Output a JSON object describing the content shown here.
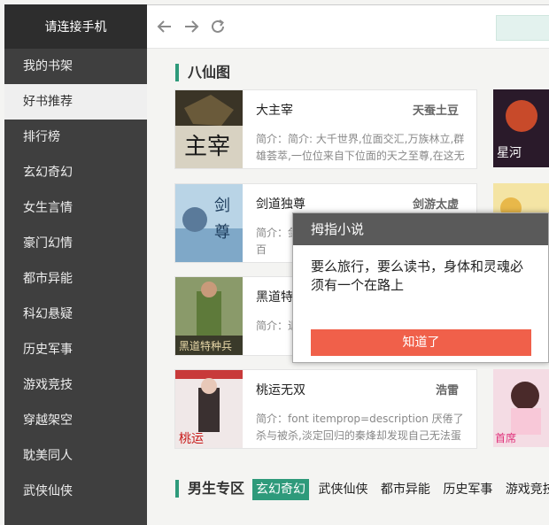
{
  "sidebar": {
    "header": "请连接手机",
    "items": [
      {
        "label": "我的书架"
      },
      {
        "label": "好书推荐"
      },
      {
        "label": "排行榜"
      },
      {
        "label": "玄幻奇幻"
      },
      {
        "label": "女生言情"
      },
      {
        "label": "豪门幻情"
      },
      {
        "label": "都市异能"
      },
      {
        "label": "科幻悬疑"
      },
      {
        "label": "历史军事"
      },
      {
        "label": "游戏竞技"
      },
      {
        "label": "穿越架空"
      },
      {
        "label": "耽美同人"
      },
      {
        "label": "武侠仙侠"
      }
    ],
    "active_index": 1
  },
  "toolbar": {
    "back_icon": "arrow-left-icon",
    "forward_icon": "arrow-right-icon",
    "reload_icon": "reload-icon"
  },
  "section1": {
    "title": "八仙图"
  },
  "books": [
    {
      "title": "大主宰",
      "author": "天蚕土豆",
      "intro": "简介：简介: 大千世界,位面交汇,万族林立,群雄荟萃,一位位来自下位面的天之至尊,在这无"
    },
    {
      "title": "剑道独尊",
      "author": "剑游太虚",
      "intro": "简介：剑道独尊 剑游太虚 一剑在手 但能过百"
    },
    {
      "title": "黑道特种兵",
      "author": "",
      "intro": "简介：退役 经的军队"
    },
    {
      "title": "桃运无双",
      "author": "浩雷",
      "intro": "简介：font itemprop=description 厌倦了杀与被杀,淡定回归的秦烽却发现自己无法蛋"
    }
  ],
  "section2": {
    "title": "男生专区"
  },
  "tabs": [
    {
      "label": "玄幻奇幻"
    },
    {
      "label": "武侠仙侠"
    },
    {
      "label": "都市异能"
    },
    {
      "label": "历史军事"
    },
    {
      "label": "游戏竞技"
    }
  ],
  "modal": {
    "title": "拇指小说",
    "message": "要么旅行，要么读书，身体和灵魂必须有一个在路上",
    "button": "知道了"
  },
  "colors": {
    "accent": "#2e9a7b",
    "button": "#f0604a",
    "sidebar": "#3f3f3f"
  }
}
